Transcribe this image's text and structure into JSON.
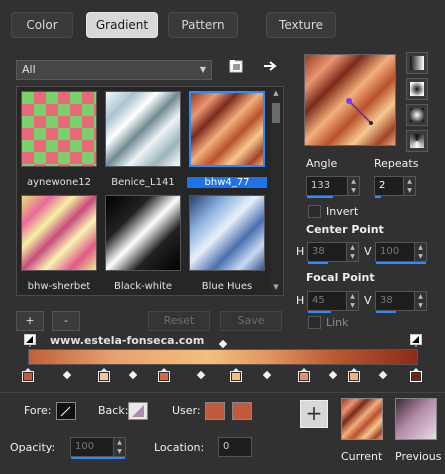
{
  "tabs": [
    {
      "label": "Color"
    },
    {
      "label": "Gradient"
    },
    {
      "label": "Pattern"
    },
    {
      "label": "Texture"
    }
  ],
  "category_select": {
    "value": "All"
  },
  "gallery": {
    "items": [
      {
        "label": "aynewone12"
      },
      {
        "label": "Benice_L141"
      },
      {
        "label": "bhw4_77"
      },
      {
        "label": "bhw-sherbet"
      },
      {
        "label": "Black-white"
      },
      {
        "label": "Blue Hues"
      }
    ]
  },
  "buttons": {
    "add": "+",
    "remove": "-",
    "reset": "Reset",
    "save": "Save"
  },
  "angle": {
    "label": "Angle",
    "value": "133"
  },
  "repeats": {
    "label": "Repeats",
    "value": "2"
  },
  "invert": {
    "label": "Invert"
  },
  "center_point": {
    "label": "Center Point",
    "h_label": "H",
    "h_value": "38",
    "v_label": "V",
    "v_value": "100"
  },
  "focal_point": {
    "label": "Focal Point",
    "h_label": "H",
    "h_value": "45",
    "v_label": "V",
    "v_value": "38"
  },
  "link": {
    "label": "Link"
  },
  "watermark": "www.estela-fonseca.com",
  "fore": {
    "label": "Fore:"
  },
  "back": {
    "label": "Back:"
  },
  "user": {
    "label": "User:"
  },
  "opacity": {
    "label": "Opacity:",
    "value": "100"
  },
  "location": {
    "label": "Location:",
    "value": "0"
  },
  "current": {
    "label": "Current"
  },
  "previous": {
    "label": "Previous"
  },
  "colors": {
    "selected": "#1e74e6",
    "user1": "#c25a3c",
    "user2": "#c25a3c"
  }
}
